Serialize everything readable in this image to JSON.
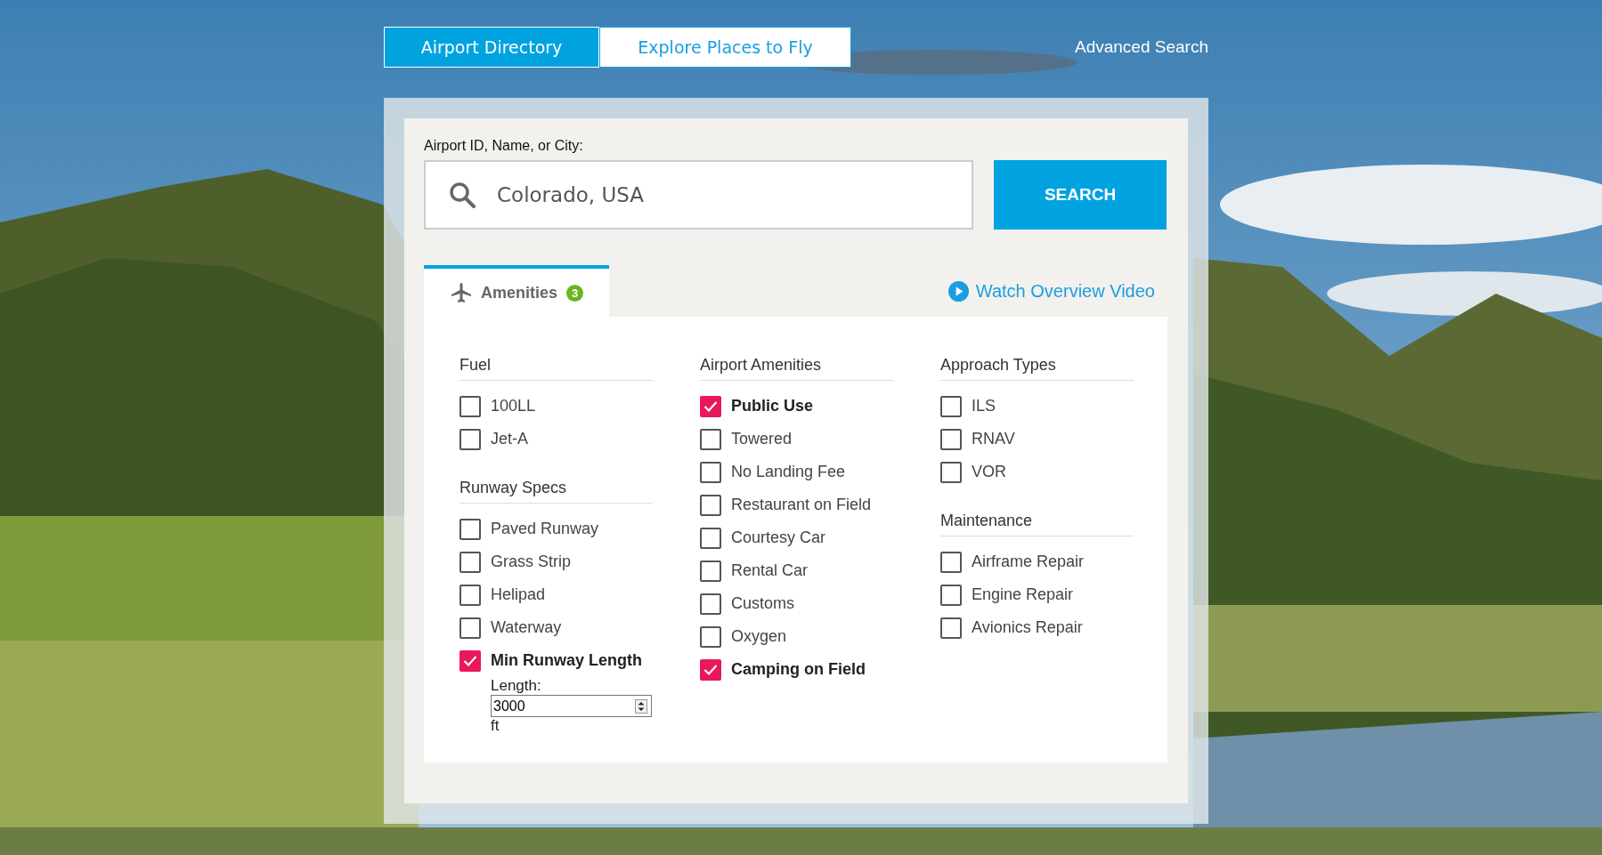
{
  "nav": {
    "tabs": [
      {
        "label": "Airport Directory",
        "selected": true
      },
      {
        "label": "Explore Places to Fly",
        "selected": false
      }
    ],
    "advanced_search": "Advanced Search"
  },
  "search": {
    "label": "Airport ID, Name, or City:",
    "value": "Colorado, USA",
    "button": "SEARCH"
  },
  "filter_tabs": [
    {
      "label": "Amenities",
      "badge": "3",
      "selected": true
    }
  ],
  "video_link": "Watch Overview Video",
  "columns": [
    {
      "groups": [
        {
          "heading": "Fuel",
          "options": [
            {
              "label": "100LL",
              "checked": false
            },
            {
              "label": "Jet-A",
              "checked": false
            }
          ]
        },
        {
          "heading": "Runway Specs",
          "options": [
            {
              "label": "Paved Runway",
              "checked": false
            },
            {
              "label": "Grass Strip",
              "checked": false
            },
            {
              "label": "Helipad",
              "checked": false
            },
            {
              "label": "Waterway",
              "checked": false
            },
            {
              "label": "Min Runway Length",
              "checked": true,
              "length": {
                "label": "Length:",
                "value": "3000",
                "unit": "ft"
              }
            }
          ]
        }
      ]
    },
    {
      "groups": [
        {
          "heading": "Airport Amenities",
          "options": [
            {
              "label": "Public Use",
              "checked": true
            },
            {
              "label": "Towered",
              "checked": false
            },
            {
              "label": "No Landing Fee",
              "checked": false
            },
            {
              "label": "Restaurant on Field",
              "checked": false
            },
            {
              "label": "Courtesy Car",
              "checked": false
            },
            {
              "label": "Rental Car",
              "checked": false
            },
            {
              "label": "Customs",
              "checked": false
            },
            {
              "label": "Oxygen",
              "checked": false
            },
            {
              "label": "Camping on Field",
              "checked": true
            }
          ]
        }
      ]
    },
    {
      "groups": [
        {
          "heading": "Approach Types",
          "options": [
            {
              "label": "ILS",
              "checked": false
            },
            {
              "label": "RNAV",
              "checked": false
            },
            {
              "label": "VOR",
              "checked": false
            }
          ]
        },
        {
          "heading": "Maintenance",
          "options": [
            {
              "label": "Airframe Repair",
              "checked": false
            },
            {
              "label": "Engine Repair",
              "checked": false
            },
            {
              "label": "Avionics Repair",
              "checked": false
            }
          ]
        }
      ]
    }
  ]
}
